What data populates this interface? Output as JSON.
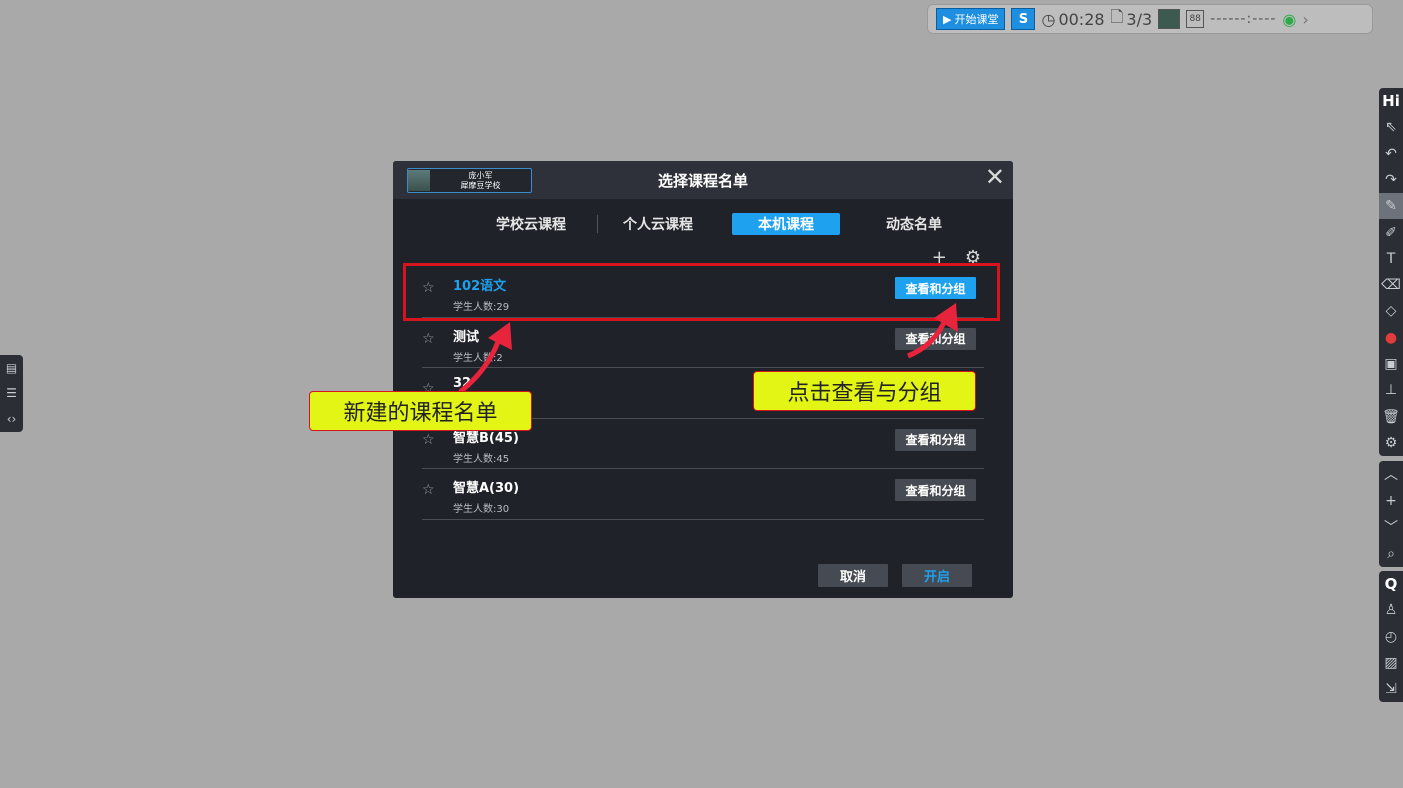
{
  "topbar": {
    "start_label": "开始课堂",
    "s_label": "S",
    "timer": "00:28",
    "pages": "3/3",
    "box_label": "88",
    "dashes": "------:----"
  },
  "dialog": {
    "user_name": "庞小军",
    "user_school": "犀摩豆学校",
    "title": "选择课程名单",
    "tabs": [
      {
        "label": "学校云课程"
      },
      {
        "label": "个人云课程"
      },
      {
        "label": "本机课程"
      },
      {
        "label": "动态名单"
      }
    ],
    "rows": [
      {
        "name": "102语文",
        "count": "学生人数:29",
        "button": "查看和分组"
      },
      {
        "name": "测试",
        "count": "学生人数:2",
        "button": "查看和分组"
      },
      {
        "name": "32",
        "count": "",
        "button": ""
      },
      {
        "name": "智慧B(45)",
        "count": "学生人数:45",
        "button": "查看和分组"
      },
      {
        "name": "智慧A(30)",
        "count": "学生人数:30",
        "button": "查看和分组"
      }
    ],
    "cancel_label": "取消",
    "open_label": "开启"
  },
  "annotations": {
    "callout_new": "新建的课程名单",
    "callout_view": "点击查看与分组"
  },
  "right_toolbar": {
    "header_1": "Hi",
    "header_2": "Q"
  },
  "colors": {
    "accent": "#1ea1ee",
    "annotation_red": "#d5141c",
    "callout_yellow": "#e2f514"
  }
}
